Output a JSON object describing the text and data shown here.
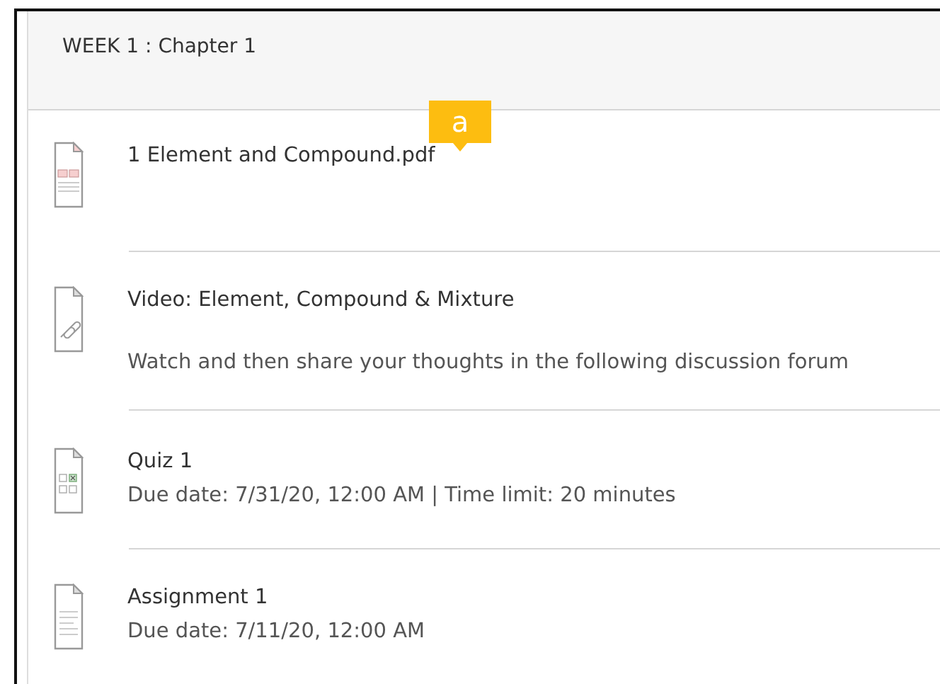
{
  "section": {
    "title": "WEEK 1 : Chapter 1"
  },
  "callout": {
    "label": "a"
  },
  "items": [
    {
      "kind": "pdf",
      "title": "1 Element and Compound.pdf"
    },
    {
      "kind": "link",
      "title": "Video: Element, Compound & Mixture",
      "description": "Watch and then share your thoughts in the following discussion forum"
    },
    {
      "kind": "quiz",
      "title": "Quiz 1",
      "details": "Due date: 7/31/20, 12:00 AM | Time limit: 20 minutes"
    },
    {
      "kind": "document",
      "title": "Assignment 1",
      "details": "Due date: 7/11/20, 12:00 AM"
    }
  ]
}
